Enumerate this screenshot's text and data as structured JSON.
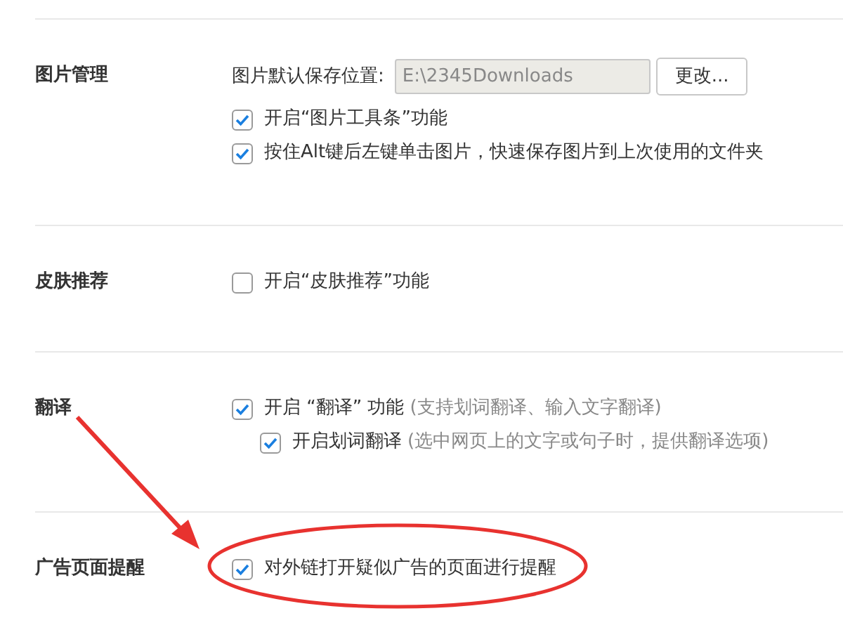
{
  "sections": [
    {
      "label": "图片管理",
      "items": [
        {
          "kind": "path",
          "label": "图片默认保存位置:",
          "value": "E:\\2345Downloads",
          "button": "更改..."
        },
        {
          "kind": "checkbox",
          "label": "开启“图片工具条”功能",
          "checked": true
        },
        {
          "kind": "checkbox",
          "label": "按住Alt键后左键单击图片，快速保存图片到上次使用的文件夹",
          "checked": true
        }
      ]
    },
    {
      "label": "皮肤推荐",
      "items": [
        {
          "kind": "checkbox",
          "label": "开启“皮肤推荐”功能",
          "checked": false
        }
      ]
    },
    {
      "label": "翻译",
      "items": [
        {
          "kind": "checkbox",
          "label": "开启 “翻译” 功能",
          "hint": "(支持划词翻译、输入文字翻译)",
          "checked": true,
          "children": [
            {
              "kind": "checkbox",
              "label": "开启划词翻译",
              "hint": "(选中网页上的文字或句子时，提供翻译选项)",
              "checked": true
            }
          ]
        }
      ]
    },
    {
      "label": "广告页面提醒",
      "items": [
        {
          "kind": "checkbox",
          "label": "对外链打开疑似广告的页面进行提醒",
          "checked": true
        }
      ]
    }
  ]
}
